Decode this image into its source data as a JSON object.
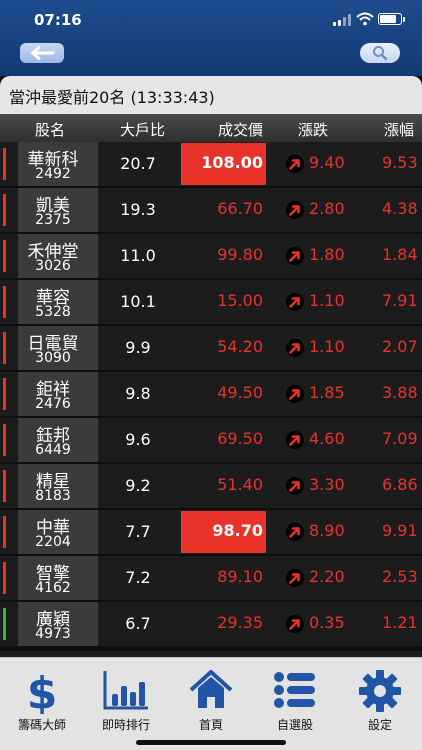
{
  "status_bar": {
    "time": "07:16"
  },
  "nav": {
    "back_icon": "back-arrow-icon",
    "search_icon": "search-icon"
  },
  "title": "當沖最愛前20名 (13:33:43)",
  "columns": [
    "股名",
    "大戶比",
    "成交價",
    "漲跌",
    "漲幅"
  ],
  "rows": [
    {
      "name": "華新科",
      "code": "2492",
      "ratio": "20.7",
      "price": "108.00",
      "change": "9.40",
      "pct": "9.53",
      "highlight": true,
      "candle": "red"
    },
    {
      "name": "凱美",
      "code": "2375",
      "ratio": "19.3",
      "price": "66.70",
      "change": "2.80",
      "pct": "4.38",
      "highlight": false,
      "candle": "red"
    },
    {
      "name": "禾伸堂",
      "code": "3026",
      "ratio": "11.0",
      "price": "99.80",
      "change": "1.80",
      "pct": "1.84",
      "highlight": false,
      "candle": "red"
    },
    {
      "name": "華容",
      "code": "5328",
      "ratio": "10.1",
      "price": "15.00",
      "change": "1.10",
      "pct": "7.91",
      "highlight": false,
      "candle": "red"
    },
    {
      "name": "日電貿",
      "code": "3090",
      "ratio": "9.9",
      "price": "54.20",
      "change": "1.10",
      "pct": "2.07",
      "highlight": false,
      "candle": "red"
    },
    {
      "name": "鉅祥",
      "code": "2476",
      "ratio": "9.8",
      "price": "49.50",
      "change": "1.85",
      "pct": "3.88",
      "highlight": false,
      "candle": "red"
    },
    {
      "name": "鈺邦",
      "code": "6449",
      "ratio": "9.6",
      "price": "69.50",
      "change": "4.60",
      "pct": "7.09",
      "highlight": false,
      "candle": "red"
    },
    {
      "name": "精星",
      "code": "8183",
      "ratio": "9.2",
      "price": "51.40",
      "change": "3.30",
      "pct": "6.86",
      "highlight": false,
      "candle": "red"
    },
    {
      "name": "中華",
      "code": "2204",
      "ratio": "7.7",
      "price": "98.70",
      "change": "8.90",
      "pct": "9.91",
      "highlight": true,
      "candle": "red"
    },
    {
      "name": "智擎",
      "code": "4162",
      "ratio": "7.2",
      "price": "89.10",
      "change": "2.20",
      "pct": "2.53",
      "highlight": false,
      "candle": "red"
    },
    {
      "name": "廣穎",
      "code": "4973",
      "ratio": "6.7",
      "price": "29.35",
      "change": "0.35",
      "pct": "1.21",
      "highlight": false,
      "candle": "green"
    }
  ],
  "tabs": [
    {
      "label": "籌碼大師",
      "icon": "dollar-icon"
    },
    {
      "label": "即時排行",
      "icon": "bar-chart-icon"
    },
    {
      "label": "首頁",
      "icon": "home-icon"
    },
    {
      "label": "自選股",
      "icon": "list-icon"
    },
    {
      "label": "設定",
      "icon": "gear-icon"
    }
  ],
  "colors": {
    "up": "#e8322a",
    "highlight_bg": "#e8322a",
    "candle_green": "#25c141",
    "nav_blue": "#1e4c8f",
    "tab_icon": "#2155a8"
  }
}
